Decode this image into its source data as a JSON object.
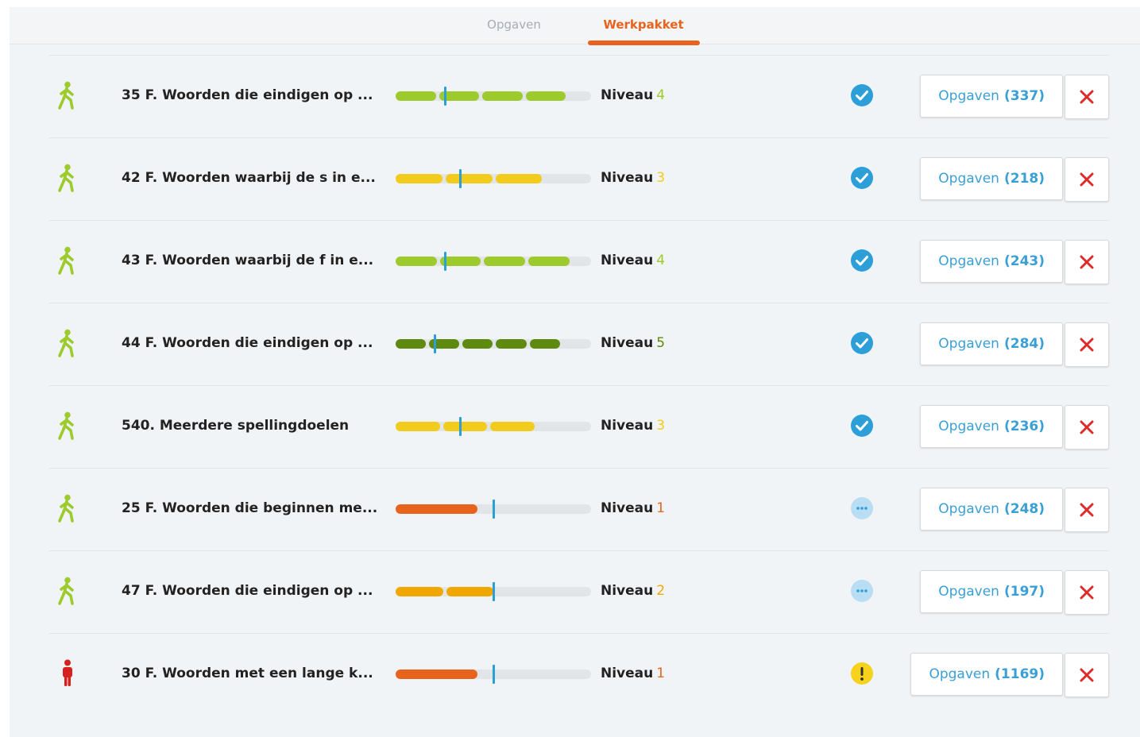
{
  "tabs": [
    {
      "label": "Opgaven",
      "active": false
    },
    {
      "label": "Werkpakket",
      "active": true
    }
  ],
  "colors": {
    "accent": "#e8641e",
    "link_blue": "#3a9fd5",
    "marker_blue": "#2d9fd8",
    "track": "#e2e5e8",
    "level_1": "#e8641e",
    "level_2": "#f0a800",
    "level_3": "#f2cc1c",
    "level_4": "#9dcb2d",
    "level_5": "#5e8a10",
    "check": "#2d9fd8",
    "pending": "#b9def3",
    "warning": "#f6d21c",
    "remove_red": "#e02a2a"
  },
  "rows": [
    {
      "icon": "walking-person-icon",
      "title": "35 F. Woorden die eindigen op ...",
      "niveau_label": "Niveau",
      "level": "4",
      "progress": 0.87,
      "marker": 0.25,
      "segments": 4,
      "status": "check-circle-icon",
      "button_label": "Opgaven",
      "count": "(337)"
    },
    {
      "icon": "walking-person-icon",
      "title": "42 F. Woorden waarbij de s in e...",
      "niveau_label": "Niveau",
      "level": "3",
      "progress": 0.75,
      "marker": 0.33,
      "segments": 3,
      "status": "check-circle-icon",
      "button_label": "Opgaven",
      "count": "(218)"
    },
    {
      "icon": "walking-person-icon",
      "title": "43 F. Woorden waarbij de f in e...",
      "niveau_label": "Niveau",
      "level": "4",
      "progress": 0.89,
      "marker": 0.25,
      "segments": 4,
      "status": "check-circle-icon",
      "button_label": "Opgaven",
      "count": "(243)"
    },
    {
      "icon": "walking-person-icon",
      "title": "44 F. Woorden die eindigen op ...",
      "niveau_label": "Niveau",
      "level": "5",
      "progress": 0.84,
      "marker": 0.2,
      "segments": 5,
      "status": "check-circle-icon",
      "button_label": "Opgaven",
      "count": "(284)"
    },
    {
      "icon": "walking-person-icon",
      "title": "540. Meerdere spellingdoelen",
      "niveau_label": "Niveau",
      "level": "3",
      "progress": 0.71,
      "marker": 0.33,
      "segments": 3,
      "status": "check-circle-icon",
      "button_label": "Opgaven",
      "count": "(236)"
    },
    {
      "icon": "walking-person-icon",
      "title": "25 F. Woorden die beginnen me...",
      "niveau_label": "Niveau",
      "level": "1",
      "progress": 0.42,
      "marker": 0.5,
      "segments": 1,
      "status": "pending-dots-icon",
      "button_label": "Opgaven",
      "count": "(248)"
    },
    {
      "icon": "walking-person-icon",
      "title": "47 F. Woorden die eindigen op ...",
      "niveau_label": "Niveau",
      "level": "2",
      "progress": 0.5,
      "marker": 0.5,
      "segments": 2,
      "status": "pending-dots-icon",
      "button_label": "Opgaven",
      "count": "(197)"
    },
    {
      "icon": "standing-person-icon",
      "title": "30 F. Woorden met een lange k...",
      "niveau_label": "Niveau",
      "level": "1",
      "progress": 0.42,
      "marker": 0.5,
      "segments": 1,
      "status": "warning-icon",
      "button_label": "Opgaven",
      "count": "(1169)"
    }
  ]
}
